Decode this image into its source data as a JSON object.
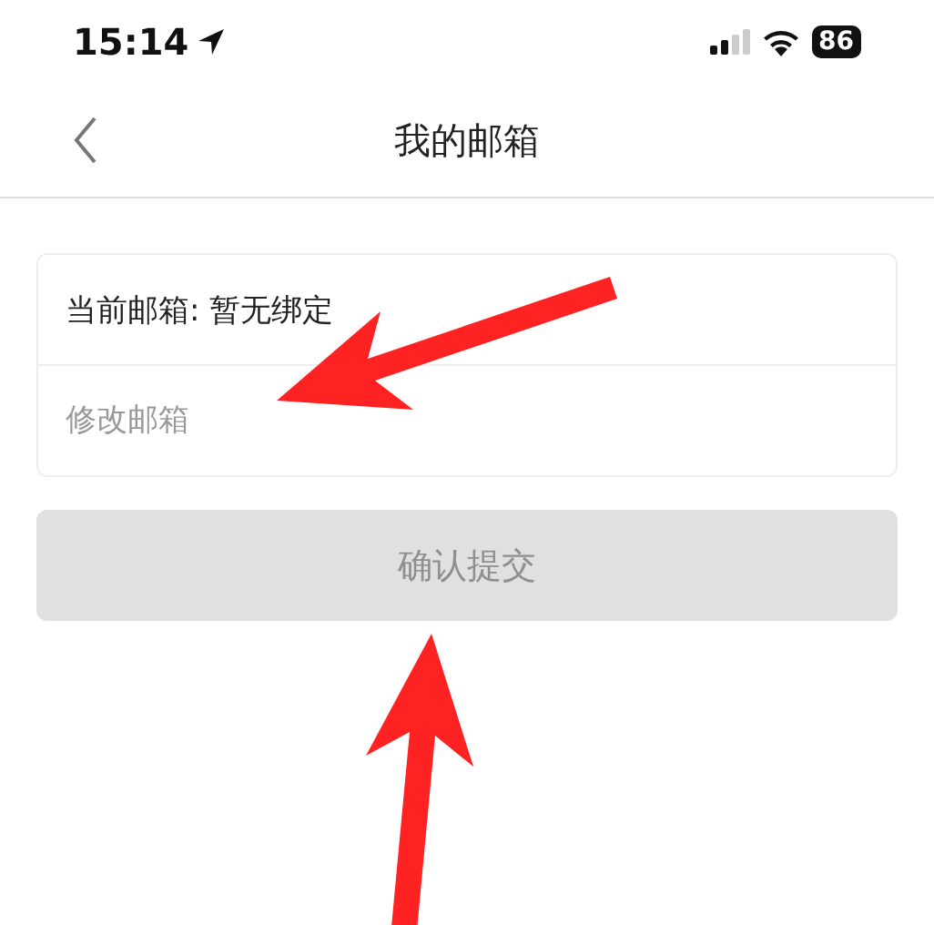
{
  "status_bar": {
    "time": "15:14",
    "battery": "86"
  },
  "nav_bar": {
    "title": "我的邮箱"
  },
  "form": {
    "current_email": "当前邮箱: 暂无绑定",
    "new_email": {
      "placeholder": "修改邮箱"
    }
  },
  "submit_button": {
    "label": "确认提交",
    "disabled": true
  }
}
